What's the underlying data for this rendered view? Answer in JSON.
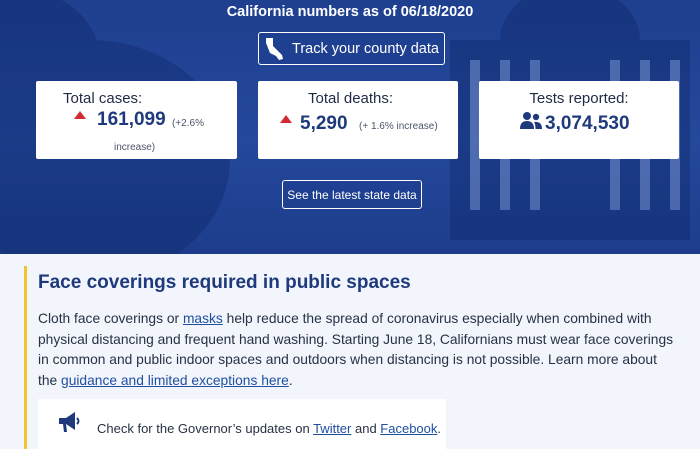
{
  "hero": {
    "title": "California numbers as of 06/18/2020",
    "track_button": "Track your county data",
    "latest_button": "See the latest state data"
  },
  "stats": {
    "cases": {
      "label": "Total cases:",
      "value": "161,099",
      "note_line1": "(+2.6%",
      "note_line2": "increase)"
    },
    "deaths": {
      "label": "Total deaths:",
      "value": "5,290",
      "note": "(+ 1.6% increase)"
    },
    "tests": {
      "label": "Tests reported:",
      "value": "3,074,530"
    }
  },
  "notice": {
    "title": "Face coverings required in public spaces",
    "p1": "Cloth face coverings or ",
    "link_masks": "masks",
    "p2": " help reduce the spread of coronavirus especially when combined with physical distancing and frequent hand washing. Starting June 18, Californians must wear face coverings in common and public indoor spaces and outdoors when distancing is not possible. Learn more about the ",
    "link_guidance": "guidance and limited exceptions here",
    "p3": "."
  },
  "updates": {
    "prefix": "Check for the Governor’s updates on ",
    "twitter": "Twitter",
    "and": " and ",
    "facebook": "Facebook",
    "suffix": "."
  },
  "colors": {
    "hero_blue": "#24489c",
    "increase_red": "#d22a33",
    "value_blue": "#1f3a7c",
    "accent_gold": "#f1c232",
    "link_blue": "#1f4fa0"
  },
  "icons": [
    "california-icon",
    "triangle-up-icon",
    "people-icon",
    "megaphone-icon"
  ]
}
